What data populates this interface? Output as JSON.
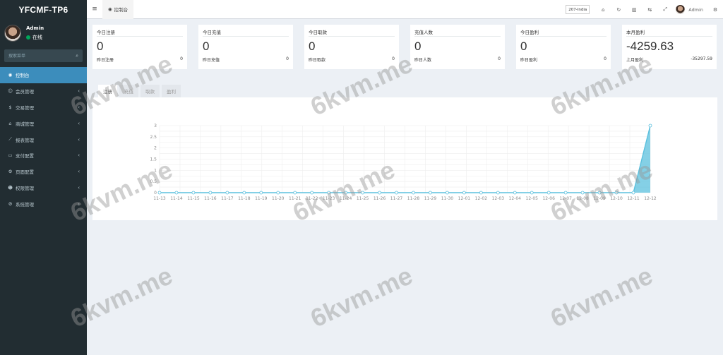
{
  "app": {
    "logo": "YFCMF-TP6"
  },
  "user": {
    "name": "Admin",
    "status": "在线"
  },
  "sidebar": {
    "search_placeholder": "搜索菜单",
    "items": [
      {
        "label": "控制台",
        "icon": "dashboard-icon",
        "glyph": "◉",
        "active": true,
        "chevron": false
      },
      {
        "label": "会员管理",
        "icon": "users-icon",
        "glyph": "☺",
        "active": false,
        "chevron": true
      },
      {
        "label": "交易管理",
        "icon": "coin-icon",
        "glyph": "$",
        "active": false,
        "chevron": true
      },
      {
        "label": "商城管理",
        "icon": "shop-icon",
        "glyph": "⌂",
        "active": false,
        "chevron": true
      },
      {
        "label": "报表管理",
        "icon": "line-chart-icon",
        "glyph": "⟋",
        "active": false,
        "chevron": true
      },
      {
        "label": "支付配置",
        "icon": "credit-card-icon",
        "glyph": "▭",
        "active": false,
        "chevron": true
      },
      {
        "label": "页面配置",
        "icon": "gear-icon",
        "glyph": "⚙",
        "active": false,
        "chevron": true
      },
      {
        "label": "权限管理",
        "icon": "user-group-icon",
        "glyph": "☻",
        "active": false,
        "chevron": true
      },
      {
        "label": "系统管理",
        "icon": "cogs-icon",
        "glyph": "⚙",
        "active": false,
        "chevron": true
      }
    ]
  },
  "header": {
    "tab_label": "控制台",
    "site_select": "207-India",
    "admin_name": "Admin",
    "icons": [
      "home-icon",
      "refresh-icon",
      "trash-icon",
      "translate-icon",
      "fullscreen-icon"
    ]
  },
  "stats": [
    {
      "title": "今日注册",
      "value": "0",
      "foot_label": "昨日注册",
      "foot_value": "0"
    },
    {
      "title": "今日充值",
      "value": "0",
      "foot_label": "昨日充值",
      "foot_value": "0"
    },
    {
      "title": "今日取款",
      "value": "0",
      "foot_label": "昨日取款",
      "foot_value": "0"
    },
    {
      "title": "充值人数",
      "value": "0",
      "foot_label": "昨日人数",
      "foot_value": "0"
    },
    {
      "title": "今日盈利",
      "value": "0",
      "foot_label": "昨日盈利",
      "foot_value": "0"
    },
    {
      "title": "本月盈利",
      "value": "-4259.63",
      "foot_label": "上月盈利",
      "foot_value": "-35297.59"
    }
  ],
  "chart_tabs": [
    "注册",
    "充值",
    "取款",
    "盈利"
  ],
  "chart_data": {
    "type": "area",
    "categories": [
      "11-13",
      "11-14",
      "11-15",
      "11-16",
      "11-17",
      "11-18",
      "11-19",
      "11-20",
      "11-21",
      "11-22",
      "11-23",
      "11-24",
      "11-25",
      "11-26",
      "11-27",
      "11-28",
      "11-29",
      "11-30",
      "12-01",
      "12-02",
      "12-03",
      "12-04",
      "12-05",
      "12-06",
      "12-07",
      "12-08",
      "12-09",
      "12-10",
      "12-11",
      "12-12"
    ],
    "values": [
      0,
      0,
      0,
      0,
      0,
      0,
      0,
      0,
      0,
      0,
      0,
      0,
      0,
      0,
      0,
      0,
      0,
      0,
      0,
      0,
      0,
      0,
      0,
      0,
      0,
      0,
      0,
      0,
      0,
      3
    ],
    "y_ticks": [
      "0",
      "0.5",
      "1",
      "1.5",
      "2",
      "2.5",
      "3"
    ],
    "ylim": [
      0,
      3
    ],
    "grid": true,
    "line_color": "#5bc0de",
    "fill_color": "#5bc0de"
  },
  "watermark": "6kvm.me",
  "colors": {
    "sidebar_bg": "#222d32",
    "active_bg": "#3c8dbc",
    "page_bg": "#ecf0f5",
    "status_green": "#00a65a"
  }
}
